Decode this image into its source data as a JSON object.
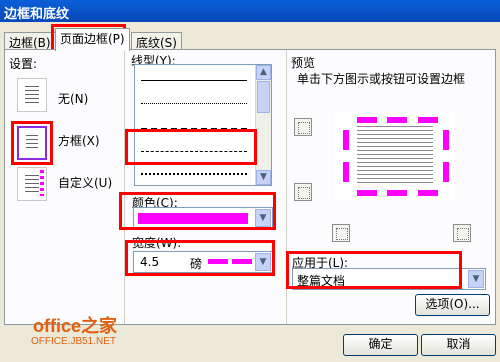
{
  "window": {
    "title": "边框和底纹"
  },
  "tabs": [
    {
      "label": "边框(B)"
    },
    {
      "label": "页面边框(P)"
    },
    {
      "label": "底纹(S)"
    }
  ],
  "setting": {
    "label": "设置:",
    "options": [
      {
        "label": "无(N)",
        "icon": "none-setting-icon"
      },
      {
        "label": "方框(X)",
        "icon": "box-setting-icon"
      },
      {
        "label": "自定义(U)",
        "icon": "custom-setting-icon"
      }
    ],
    "selected": "方框(X)"
  },
  "style": {
    "label": "线型(Y):",
    "selected_index": 3
  },
  "color": {
    "label": "颜色(C):",
    "value_color": "#ff00ff"
  },
  "width": {
    "label": "宽度(W):",
    "value": "4.5",
    "unit": "磅"
  },
  "preview": {
    "label": "预览",
    "hint": "单击下方图示或按钮可设置边框",
    "border_color": "#ff00ff"
  },
  "apply_to": {
    "label": "应用于(L):",
    "value": "整篇文档"
  },
  "buttons": {
    "options": "选项(O)...",
    "ok": "确定",
    "cancel": "取消"
  },
  "watermark": {
    "logo": "office之家",
    "url": "OFFICE.JB51.NET"
  },
  "colors": {
    "highlight": "#ff0000",
    "accent": "#ff00ff"
  }
}
